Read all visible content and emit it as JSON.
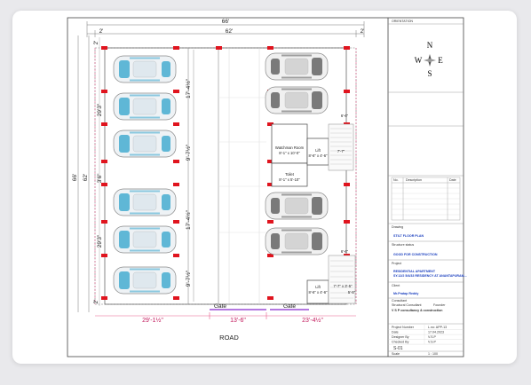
{
  "plan": {
    "overall_width": "66'",
    "inner_width": "62'",
    "side_margin": "2'",
    "overall_depth": "66'",
    "inner_depth": "62'",
    "left_dims": [
      "2'",
      "29'3\"",
      "3'6\"",
      "29'3\"",
      "2'"
    ],
    "middle_dims": [
      "17'-4½\"",
      "9'-7½\"",
      "17'-4½\"",
      "9'-7½\""
    ],
    "gate_label": "Gate",
    "bottom_dims": [
      "29'-1½\"",
      "13'-6\"",
      "23'-4½\""
    ],
    "road_label": "ROAD",
    "watchman_room": {
      "name": "Watchman Room",
      "size": "8'-1\" x 10'-0\""
    },
    "lift_top": {
      "name": "Lift",
      "size": "8'-6\" x 4'-6\"",
      "side": "7'-7\"",
      "top": "6'-6\""
    },
    "toilet": {
      "name": "Toilet",
      "size": "8'-1\" x 5'-10\""
    },
    "lift_bottom": {
      "name": "Lift",
      "size": "8'-6\" x 4'-6\"",
      "side": "7'-7\" x 3'-5\"",
      "top": "6'-6\"",
      "right": "5'-5\""
    }
  },
  "title_block": {
    "orientation_label": "ORIENTATION",
    "compass": {
      "n": "N",
      "s": "S",
      "e": "E",
      "w": "W"
    },
    "table_headers": [
      "No.",
      "Description",
      "Date"
    ],
    "drawing_label": "Drawing",
    "drawing_value": "STILT FLOOR PLAN",
    "status_label": "Structure status",
    "status_value": "GOOD FOR CONSTRUCTION",
    "project_label": "Project",
    "project_value": "RESIDENTIAL APARTMENT\nSY.12/2 5/4/33 RESIDENCY AT ANANTAPURAM...",
    "client_label": "Client",
    "client_value": "Mr.Pratap Reddy",
    "consultant_label": "Consultant",
    "structural_label": "Structural Consultant",
    "founder_label": "Founder",
    "company_value": "V S P consultancy & construction",
    "fields": [
      {
        "label": "Project Number",
        "value": "L.no: APP-13"
      },
      {
        "label": "Date",
        "value": "17.04.2023"
      },
      {
        "label": "Designer By",
        "value": "V.S.P"
      },
      {
        "label": "Checked By",
        "value": "V.S.P"
      }
    ],
    "sheet_no": "S-01",
    "scale_label": "Scale",
    "scale_value": "1 : 100"
  }
}
